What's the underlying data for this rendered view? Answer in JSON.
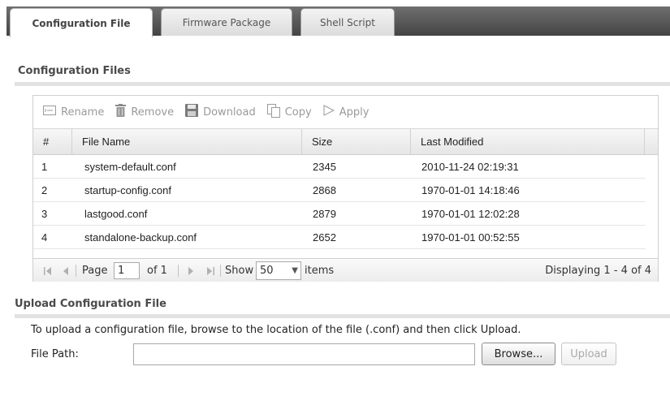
{
  "tabs": [
    {
      "label": "Configuration File",
      "active": true
    },
    {
      "label": "Firmware Package",
      "active": false
    },
    {
      "label": "Shell Script",
      "active": false
    }
  ],
  "config_section": {
    "title": "Configuration Files",
    "toolbar": {
      "rename": "Rename",
      "remove": "Remove",
      "download": "Download",
      "copy": "Copy",
      "apply": "Apply"
    },
    "columns": [
      "#",
      "File Name",
      "Size",
      "Last Modified"
    ],
    "rows": [
      {
        "num": "1",
        "name": "system-default.conf",
        "size": "2345",
        "modified": "2010-11-24 02:19:31"
      },
      {
        "num": "2",
        "name": "startup-config.conf",
        "size": "2868",
        "modified": "1970-01-01 14:18:46"
      },
      {
        "num": "3",
        "name": "lastgood.conf",
        "size": "2879",
        "modified": "1970-01-01 12:02:28"
      },
      {
        "num": "4",
        "name": "standalone-backup.conf",
        "size": "2652",
        "modified": "1970-01-01 00:52:55"
      }
    ],
    "pager": {
      "page_label": "Page",
      "page_value": "1",
      "of_label": "of 1",
      "show_label": "Show",
      "show_value": "50",
      "items_label": "items",
      "displaying": "Displaying 1 - 4 of 4"
    }
  },
  "upload_section": {
    "title": "Upload Configuration File",
    "instructions": "To upload a configuration file, browse to the location of the file (.conf) and then click Upload.",
    "file_path_label": "File Path:",
    "file_path_value": "",
    "browse_label": "Browse...",
    "upload_label": "Upload"
  },
  "icons": {
    "rename": "rename-icon",
    "remove": "trash-icon",
    "download": "save-icon",
    "copy": "copy-icon",
    "apply": "play-icon"
  }
}
